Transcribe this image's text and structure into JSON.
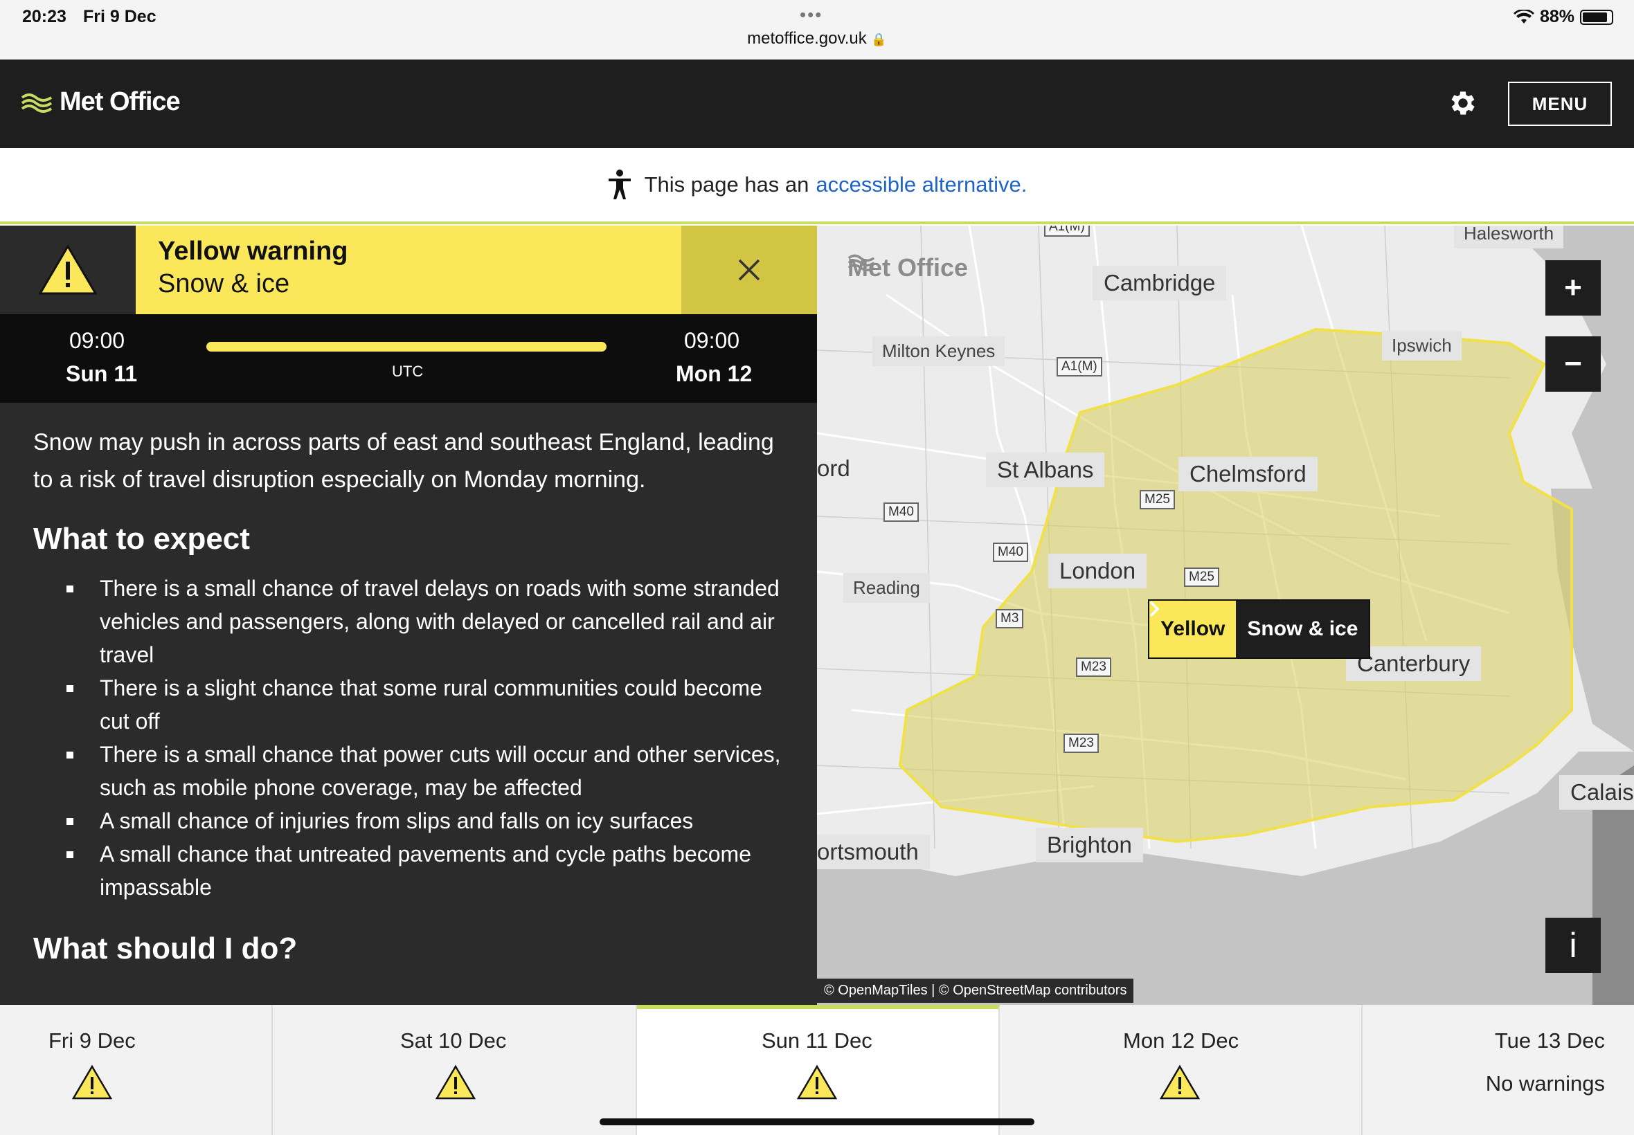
{
  "status": {
    "time": "20:23",
    "date": "Fri 9 Dec",
    "url": "metoffice.gov.uk",
    "battery": "88%",
    "battery_level": 0.88
  },
  "header": {
    "logo": "Met Office",
    "menu_label": "MENU"
  },
  "accessible": {
    "prefix": "This page has an",
    "link": "accessible alternative."
  },
  "warning": {
    "title": "Yellow warning",
    "subtitle": "Snow & ice",
    "start_time": "09:00",
    "start_day": "Sun 11",
    "end_time": "09:00",
    "end_day": "Mon 12",
    "timezone": "UTC",
    "color": "#fbe85a",
    "intro": "Snow may push in across parts of east and southeast England, leading to a risk of travel disruption especially on Monday morning.",
    "expect_heading": "What to expect",
    "bullets": [
      "There is a small chance of travel delays on roads with some stranded vehicles and passengers, along with delayed or cancelled rail and air travel",
      "There is a slight chance that some rural communities could become cut off",
      "There is a small chance that power cuts will occur and other services, such as mobile phone coverage, may be affected",
      "A small chance of injuries from slips and falls on icy surfaces",
      "A small chance that untreated pavements and cycle paths become impassable"
    ],
    "do_heading": "What should I do?"
  },
  "map": {
    "watermark": "Met Office",
    "labels": {
      "cambridge": "Cambridge",
      "milton_keynes": "Milton Keynes",
      "st_albans": "St Albans",
      "chelmsford": "Chelmsford",
      "london": "London",
      "reading": "Reading",
      "canterbury": "Canterbury",
      "brighton": "Brighton",
      "portsmouth": "ortsmouth",
      "ipswich": "Ipswich",
      "halesworth": "Halesworth",
      "calais": "Calais",
      "ford": "ord",
      "a1m_top": "A1(M)"
    },
    "roads": {
      "a1m": "A1(M)",
      "m40a": "M40",
      "m40b": "M40",
      "m25a": "M25",
      "m25b": "M25",
      "m3": "M3",
      "m23a": "M23",
      "m23b": "M23"
    },
    "zoom_in": "+",
    "zoom_out": "−",
    "info": "i",
    "pill_level": "Yellow",
    "pill_type": "Snow & ice",
    "attribution": "© OpenMapTiles | © OpenStreetMap contributors"
  },
  "days": [
    {
      "label": "Fri 9 Dec",
      "warning": true
    },
    {
      "label": "Sat 10 Dec",
      "warning": true
    },
    {
      "label": "Sun 11 Dec",
      "warning": true,
      "active": true
    },
    {
      "label": "Mon 12 Dec",
      "warning": true
    },
    {
      "label": "Tue 13 Dec",
      "warning": false,
      "note": "No warnings"
    }
  ]
}
